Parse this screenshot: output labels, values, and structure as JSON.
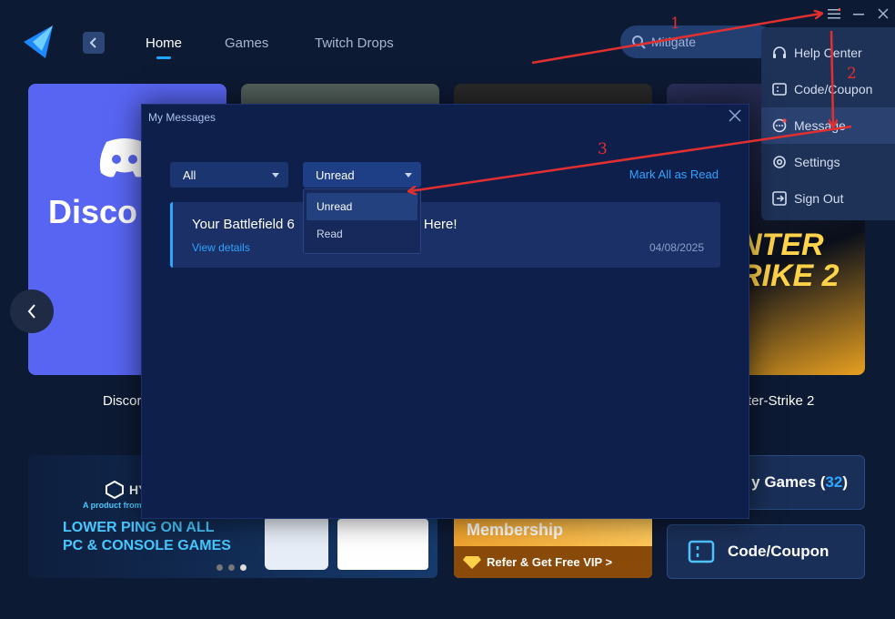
{
  "nav": {
    "tabs": [
      {
        "label": "Home",
        "active": true
      },
      {
        "label": "Games",
        "active": false
      },
      {
        "label": "Twitch Drops",
        "active": false
      }
    ]
  },
  "search": {
    "value": "Mitigate",
    "placeholder": ""
  },
  "cards": [
    {
      "label": "Discord",
      "art_text": "Disco"
    },
    {
      "label": "",
      "art_text": ""
    },
    {
      "label": "",
      "art_text": ""
    },
    {
      "label": "Counter-Strike 2",
      "art_text": "NTER\nRIKE 2"
    }
  ],
  "card_labels_visible": {
    "discord": "Discor",
    "cs": "ter-Strike 2"
  },
  "banners": {
    "ping": {
      "brand": "HY",
      "sub": "A product from",
      "line1": "LOWER PING ON ALL",
      "line2": "PC & CONSOLE GAMES",
      "slides": 3,
      "active_slide": 3
    },
    "vip": {
      "title": "Membership",
      "cta": "Refer & Get Free VIP >"
    }
  },
  "side_buttons": {
    "my_games": {
      "label": "y Games (",
      "count": "32",
      "suffix": ")"
    },
    "coupon": {
      "label": "Code/Coupon"
    }
  },
  "menu": {
    "items": [
      {
        "label": "Help Center",
        "icon": "headset-icon"
      },
      {
        "label": "Code/Coupon",
        "icon": "ticket-icon"
      },
      {
        "label": "Message",
        "icon": "chat-bubble-icon",
        "hover": true
      },
      {
        "label": "Settings",
        "icon": "gear-icon"
      },
      {
        "label": "Sign Out",
        "icon": "sign-out-icon"
      }
    ]
  },
  "modal": {
    "title": "My Messages",
    "filter_category": "All",
    "filter_status": "Unread",
    "mark_all_label": "Mark All as Read",
    "status_options": [
      {
        "label": "Unread",
        "selected": true
      },
      {
        "label": "Read",
        "selected": false
      }
    ],
    "messages": [
      {
        "title_start": "Your Battlefield 6",
        "title_end": "is Here!",
        "link": "View details",
        "date": "04/08/2025"
      }
    ]
  },
  "annotations": [
    "1",
    "2",
    "3"
  ],
  "colors": {
    "accent": "#20a8ff",
    "background": "#0d1a33",
    "modal_bg": "#0e1f4c",
    "annotation": "#e23030",
    "discord": "#5865f2"
  }
}
